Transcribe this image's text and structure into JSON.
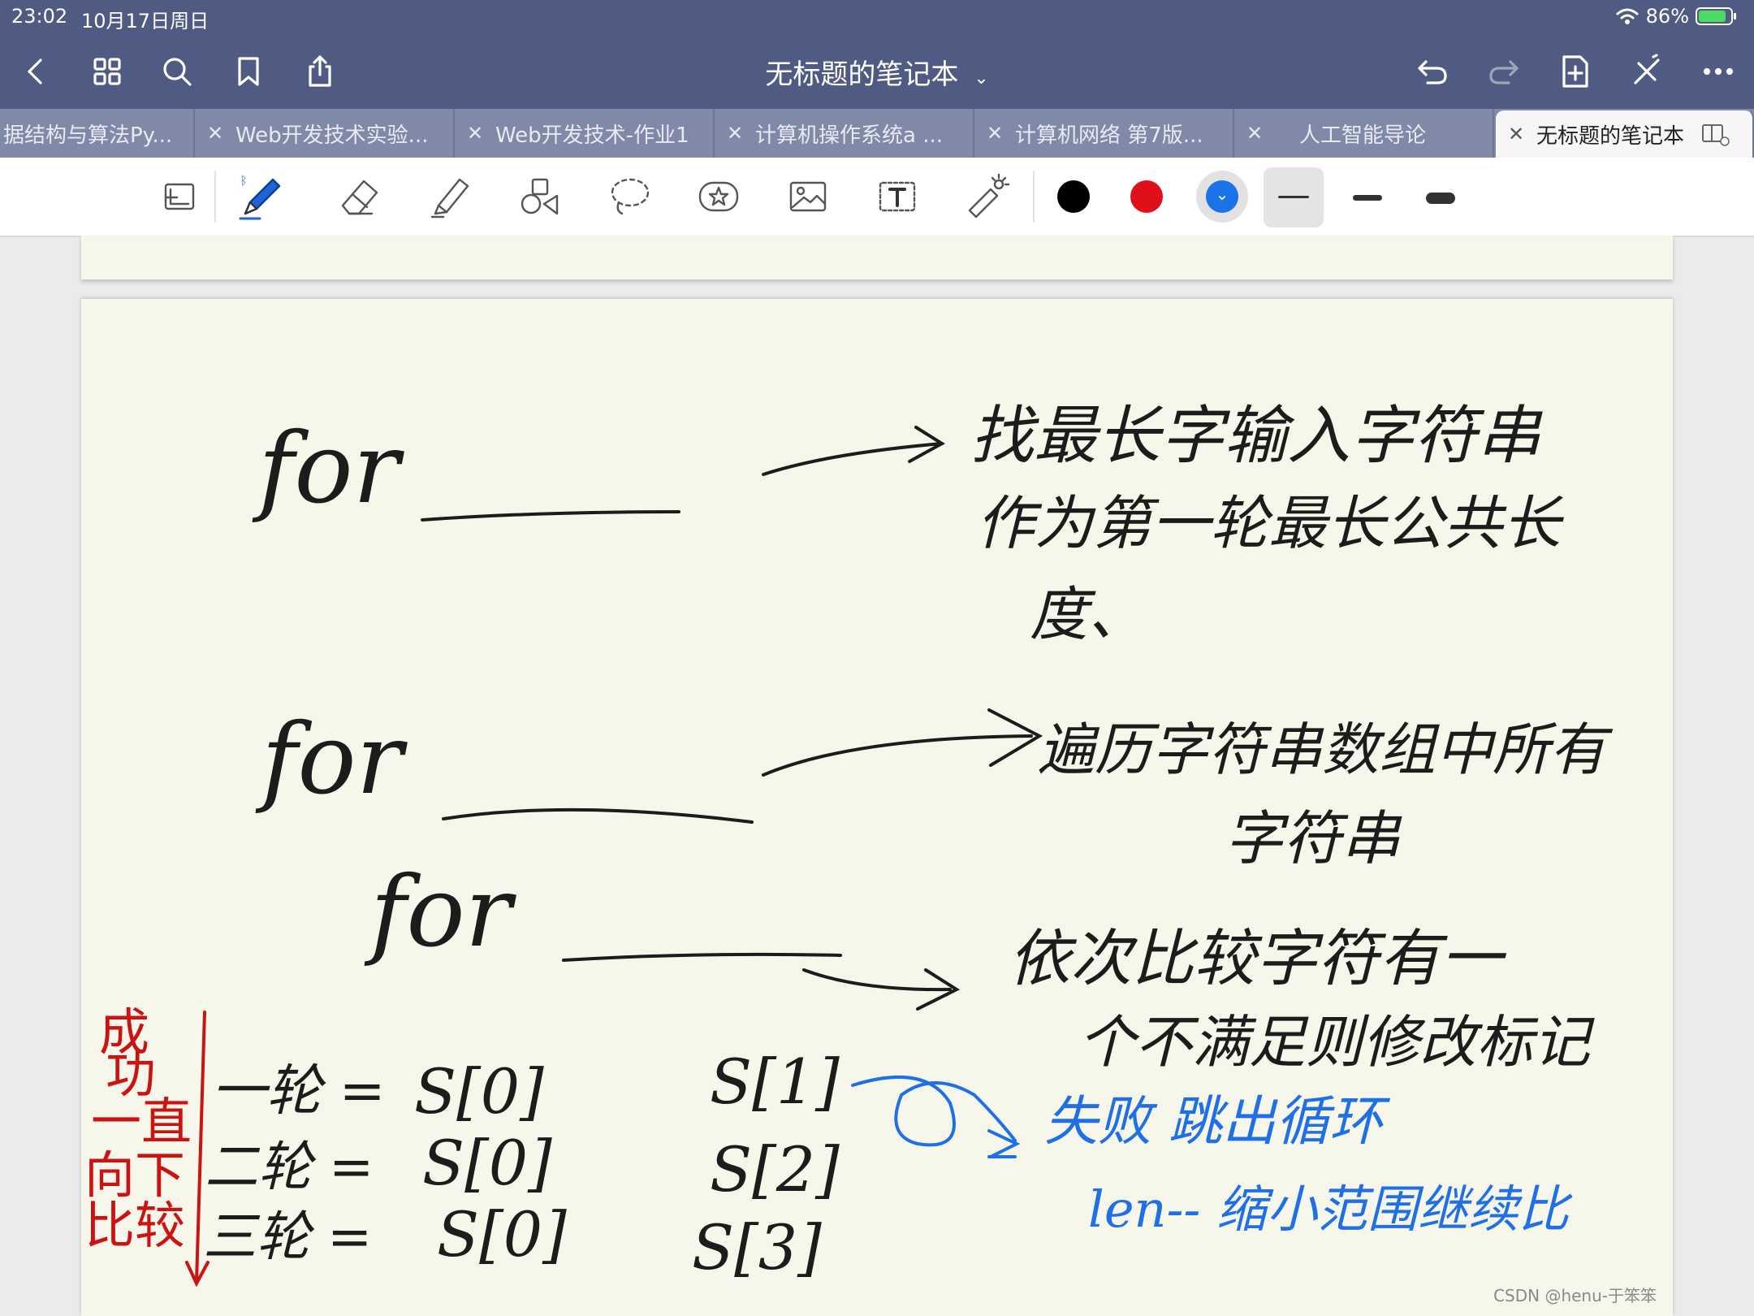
{
  "status_bar": {
    "time": "23:02",
    "date": "10月17日周日",
    "battery": "86%",
    "battery_level": 0.86
  },
  "nav": {
    "title": "无标题的笔记本",
    "icons": [
      "back-icon",
      "grid-icon",
      "search-icon",
      "bookmark-icon",
      "share-icon",
      "undo-icon",
      "redo-icon",
      "add-page-icon",
      "close-toolbar-icon",
      "more-icon"
    ]
  },
  "tabs": [
    {
      "label": "据结构与算法Py...",
      "closable": false
    },
    {
      "label": "Web开发技术实验...",
      "closable": true
    },
    {
      "label": "Web开发技术-作业1",
      "closable": true
    },
    {
      "label": "计算机操作系统a ...",
      "closable": true
    },
    {
      "label": "计算机网络 第7版...",
      "closable": true
    },
    {
      "label": "人工智能导论",
      "closable": true
    },
    {
      "label": "无标题的笔记本",
      "closable": true,
      "active": true
    }
  ],
  "toolbar": {
    "tools": [
      "page-view-icon",
      "pen-icon",
      "eraser-icon",
      "highlighter-icon",
      "shapes-icon",
      "lasso-icon",
      "sticker-icon",
      "image-icon",
      "text-icon",
      "laser-pointer-icon"
    ],
    "colors": [
      "#000000",
      "#e0101a",
      "#1a73e8"
    ],
    "selected_color": "#1a73e8",
    "selected_width_index": 0
  },
  "note": {
    "line1_code": "for",
    "line1_text1": "找最长字输入字符串",
    "line1_text2": "作为第一轮最长公共长",
    "line1_text3": "度、",
    "line2_code": "for",
    "line2_text1": "遍历字符串数组中所有",
    "line2_text2": "字符串",
    "line3_code": "for",
    "line3_text1": "依次比较字符有一",
    "line3_text2": "个不满足则修改标记",
    "red_note": [
      "成",
      "功",
      "一直",
      "向下",
      "比较"
    ],
    "rows": [
      {
        "label": "一轮 =",
        "left": "S[0]",
        "right": "S[1]"
      },
      {
        "label": "二轮 =",
        "left": "S[0]",
        "right": "S[2]"
      },
      {
        "label": "三轮 =",
        "left": "S[0]",
        "right": "S[3]"
      }
    ],
    "blue_text1": "失败 跳出循环",
    "blue_text2": "len-- 缩小范围继续比"
  },
  "watermark": "CSDN @henu-于笨笨"
}
